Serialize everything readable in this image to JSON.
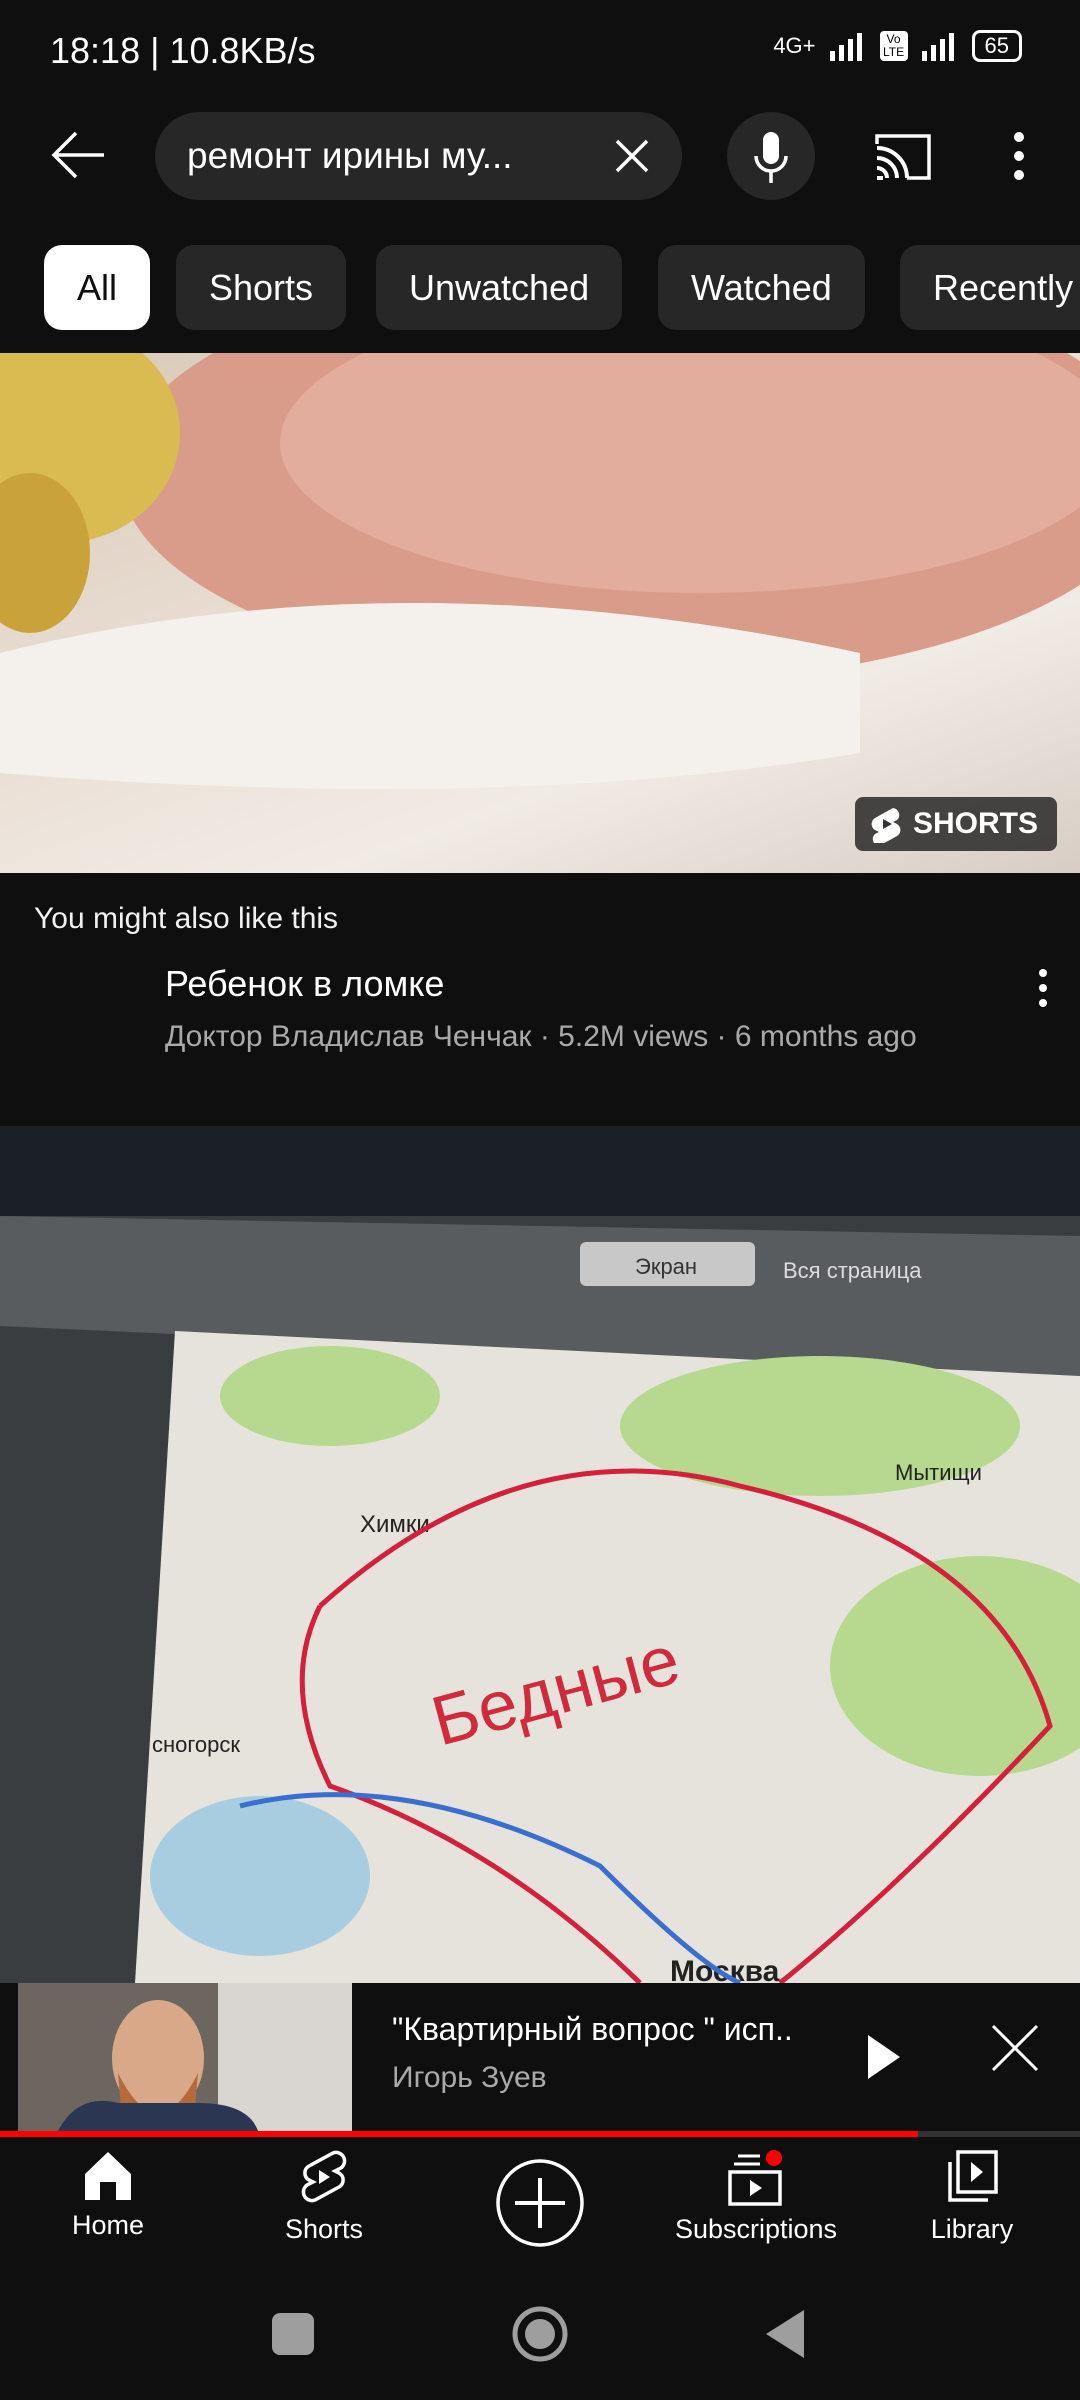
{
  "status_bar": {
    "left": "18:18 | 10.8KB/s",
    "network": "4G+",
    "volte": "Vo LTE",
    "battery": "65"
  },
  "search": {
    "query": "ремонт ирины му...",
    "icons": [
      "back-arrow-icon",
      "clear-icon",
      "mic-icon",
      "cast-icon",
      "more-vert-icon"
    ]
  },
  "chips": [
    {
      "label": "All",
      "active": true
    },
    {
      "label": "Shorts"
    },
    {
      "label": "Unwatched"
    },
    {
      "label": "Watched"
    },
    {
      "label": "Recently"
    }
  ],
  "shorts_badge": "SHORTS",
  "section_label": "You might also like this",
  "video": {
    "title": "Ребенок в ломке",
    "meta": "Доктор Владислав Ченчак · 5.2M views · 6 months ago"
  },
  "map_labels": {
    "tab1": "Экран",
    "tab2": "Вся страница",
    "city1": "Химки",
    "city2": "Мытищи",
    "city3": "сногорск",
    "city4": "Москва",
    "word": "Бедные"
  },
  "mini_player": {
    "title": "\"Квартирный вопрос \" исп..",
    "channel": "Игорь Зуев",
    "progress_percent": 85,
    "progress_color": "#ff0000"
  },
  "bottom_nav": [
    {
      "label": "Home",
      "icon": "home-icon"
    },
    {
      "label": "Shorts",
      "icon": "shorts-icon"
    },
    {
      "label": "",
      "icon": "create-icon"
    },
    {
      "label": "Subscriptions",
      "icon": "subscriptions-icon",
      "badge": true
    },
    {
      "label": "Library",
      "icon": "library-icon"
    }
  ]
}
